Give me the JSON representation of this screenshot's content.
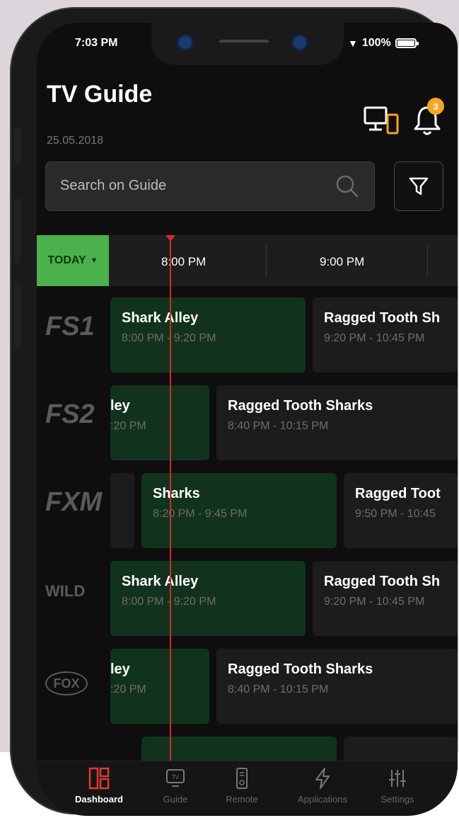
{
  "status": {
    "time": "7:03 PM",
    "battery": "100%"
  },
  "header": {
    "title": "TV Guide",
    "date": "25.05.2018",
    "notifications_count": "3"
  },
  "search": {
    "placeholder": "Search on Guide"
  },
  "timeline": {
    "day_label": "TODAY",
    "slots": [
      "8:00 PM",
      "9:00 PM"
    ]
  },
  "channels": [
    {
      "logo": "FS1",
      "programs": [
        {
          "title": "Shark Alley",
          "time": "8:00 PM - 9:20 PM",
          "style": "green"
        },
        {
          "title": "Ragged Tooth Sh",
          "time": "9:20 PM - 10:45 PM",
          "style": "dark"
        }
      ]
    },
    {
      "logo": "FS2",
      "programs": [
        {
          "title": "ley",
          "time": ":20 PM",
          "style": "green"
        },
        {
          "title": "Ragged Tooth Sharks",
          "time": "8:40 PM - 10:15 PM",
          "style": "dark"
        }
      ]
    },
    {
      "logo": "FXM",
      "programs": [
        {
          "title": "",
          "time": "",
          "style": "dark"
        },
        {
          "title": "Sharks",
          "time": "8:20 PM - 9:45 PM",
          "style": "green"
        },
        {
          "title": "Ragged Toot",
          "time": "9:50 PM - 10:45",
          "style": "dark"
        }
      ]
    },
    {
      "logo": "WILD",
      "programs": [
        {
          "title": "Shark Alley",
          "time": "8:00 PM - 9:20 PM",
          "style": "green"
        },
        {
          "title": "Ragged Tooth Sh",
          "time": "9:20 PM - 10:45 PM",
          "style": "dark"
        }
      ]
    },
    {
      "logo": "FOX",
      "programs": [
        {
          "title": "ley",
          "time": ":20 PM",
          "style": "green"
        },
        {
          "title": "Ragged Tooth Sharks",
          "time": "8:40 PM - 10:15 PM",
          "style": "dark"
        }
      ]
    }
  ],
  "tabs": [
    {
      "label": "Dashboard",
      "icon": "dashboard-icon",
      "active": true
    },
    {
      "label": "Guide",
      "icon": "tv-icon",
      "active": false
    },
    {
      "label": "Remote",
      "icon": "remote-icon",
      "active": false
    },
    {
      "label": "Applications",
      "icon": "lightning-icon",
      "active": false
    },
    {
      "label": "Settings",
      "icon": "sliders-icon",
      "active": false
    }
  ],
  "colors": {
    "accent": "#4cb04c",
    "now_line": "#d42a2a",
    "active_tab": "#e53935",
    "badge": "#f5a623"
  }
}
